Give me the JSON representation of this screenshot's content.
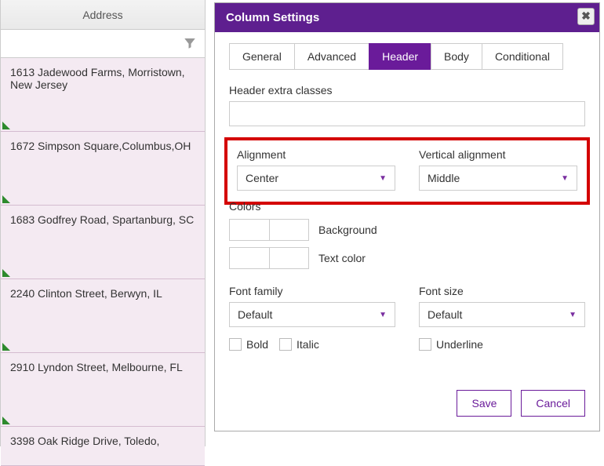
{
  "column": {
    "header": "Address",
    "cells": [
      "1613 Jadewood Farms, Morristown, New Jersey",
      "1672 Simpson Square,Columbus,OH",
      "1683 Godfrey Road, Spartanburg, SC",
      "2240 Clinton Street, Berwyn, IL",
      "2910 Lyndon Street, Melbourne, FL",
      "3398 Oak Ridge Drive, Toledo,"
    ]
  },
  "panel": {
    "title": "Column Settings",
    "tabs": [
      "General",
      "Advanced",
      "Header",
      "Body",
      "Conditional"
    ],
    "active_tab": 2,
    "header_extra_classes_label": "Header extra classes",
    "header_extra_classes_value": "",
    "alignment": {
      "label": "Alignment",
      "value": "Center"
    },
    "valignment": {
      "label": "Vertical alignment",
      "value": "Middle"
    },
    "colors": {
      "label": "Colors",
      "background_label": "Background",
      "textcolor_label": "Text color"
    },
    "font_family": {
      "label": "Font family",
      "value": "Default"
    },
    "font_size": {
      "label": "Font size",
      "value": "Default"
    },
    "bold_label": "Bold",
    "italic_label": "Italic",
    "underline_label": "Underline",
    "save_label": "Save",
    "cancel_label": "Cancel"
  }
}
